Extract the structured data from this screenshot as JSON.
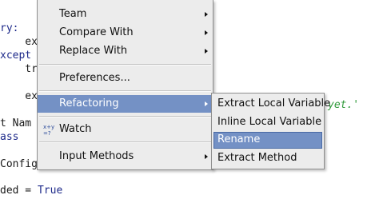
{
  "editor": {
    "lines": [
      "ry:",
      "    ex",
      "xcept",
      "    tr",
      "    ex",
      "t Nam",
      "ass",
      "Config",
      "ded = "
    ],
    "comment_fragment": "yet.'",
    "true_keyword": "True"
  },
  "context_menu": {
    "items": [
      {
        "label": "Team",
        "submenu": true
      },
      {
        "label": "Compare With",
        "submenu": true
      },
      {
        "label": "Replace With",
        "submenu": true
      },
      {
        "label": "Preferences...",
        "submenu": false
      },
      {
        "label": "Refactoring",
        "submenu": true
      },
      {
        "label": "Watch",
        "submenu": false,
        "icon": "watch-expression-icon"
      },
      {
        "label": "Input Methods",
        "submenu": true
      }
    ],
    "active_item": "Refactoring"
  },
  "refactoring_submenu": {
    "items": [
      {
        "label": "Extract Local Variable"
      },
      {
        "label": "Inline Local Variable"
      },
      {
        "label": "Rename"
      },
      {
        "label": "Extract Method"
      }
    ],
    "active_item": "Rename"
  },
  "colors": {
    "menu_bg": "#ececec",
    "highlight": "#7491c5",
    "comment": "#2f9a3a",
    "keyword": "#1e2a8a"
  }
}
